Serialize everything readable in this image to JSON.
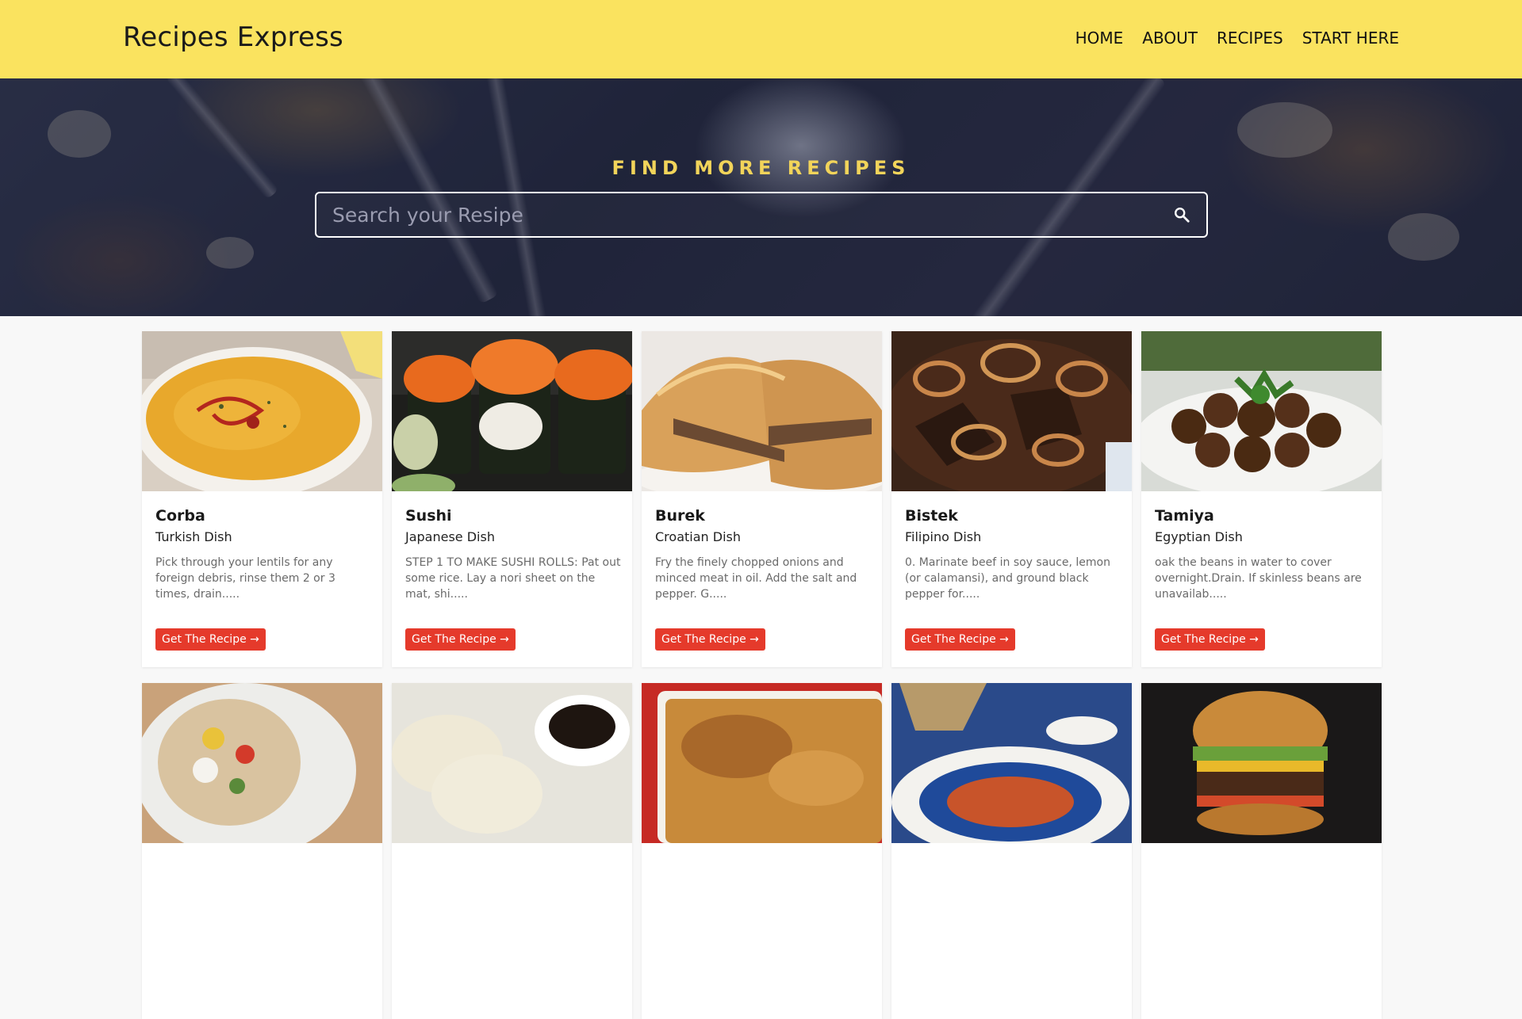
{
  "header": {
    "brand": "Recipes Express",
    "nav": [
      "HOME",
      "ABOUT",
      "RECIPES",
      "START HERE"
    ],
    "background_color": "#fae35f"
  },
  "hero": {
    "title": "FIND MORE RECIPES",
    "search_placeholder": "Search your Resipe",
    "title_color": "#f2d45a"
  },
  "recipes": [
    {
      "name": "Corba",
      "origin": "Turkish Dish",
      "description": "Pick through your lentils for any foreign debris, rinse them 2 or 3 times, drain.....",
      "button": "Get The Recipe →",
      "image": "lentil-soup-photo"
    },
    {
      "name": "Sushi",
      "origin": "Japanese Dish",
      "description": "STEP 1 TO MAKE SUSHI ROLLS: Pat out some rice. Lay a nori sheet on the mat, shi.....",
      "button": "Get The Recipe →",
      "image": "sushi-rolls-photo"
    },
    {
      "name": "Burek",
      "origin": "Croatian Dish",
      "description": "Fry the finely chopped onions and minced meat in oil. Add the salt and pepper. G.....",
      "button": "Get The Recipe →",
      "image": "burek-pastry-photo"
    },
    {
      "name": "Bistek",
      "origin": "Filipino Dish",
      "description": "0. Marinate beef in soy sauce, lemon (or calamansi), and ground black pepper for.....",
      "button": "Get The Recipe →",
      "image": "beef-steak-onions-photo"
    },
    {
      "name": "Tamiya",
      "origin": "Egyptian Dish",
      "description": "oak the beans in water to cover overnight.Drain. If skinless beans are unavailab.....",
      "button": "Get The Recipe →",
      "image": "falafel-photo"
    }
  ],
  "second_row_images": [
    "stuffed-potato-photo",
    "dumplings-photo",
    "lasagna-photo",
    "tagine-plate-photo",
    "burger-photo"
  ],
  "button_color": "#e53a2b"
}
